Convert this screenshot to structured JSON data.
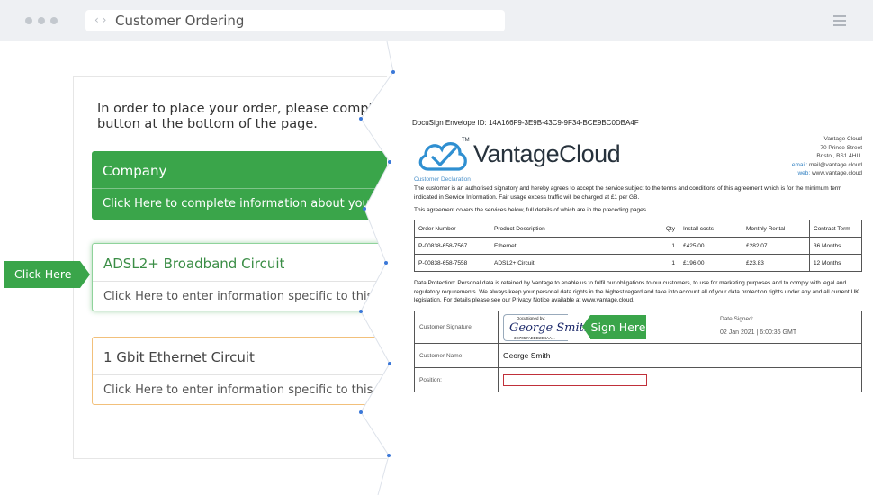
{
  "window": {
    "title": "Customer Ordering"
  },
  "form": {
    "intro": "In order to place your order, please complete all the information required for each section. Click on a section to start, then click the submit button at the bottom of the page.",
    "intro_visible_line1": "In order to place your order, please complete all",
    "intro_visible_line2": "button at the bottom of the page.",
    "cards": [
      {
        "title": "Company",
        "subtitle": "Click Here to complete information about your company",
        "state": "complete",
        "color": "#3aa54a"
      },
      {
        "title": "ADSL2+ Broadband Circuit",
        "subtitle": "Click Here to enter information specific to this Broadband circuit",
        "state": "active",
        "color": "#8fd39b"
      },
      {
        "title": "1 Gbit Ethernet Circuit",
        "subtitle": "Click Here to enter information specific to this Ethernet Service",
        "state": "pending",
        "color": "#f2c07b"
      }
    ],
    "click_here_label": "Click Here"
  },
  "document": {
    "envelope_id": "DocuSign Envelope ID: 14A166F9-3E9B-43C9-9F34-BCE9BC0DBA4F",
    "brand": "VantageCloud",
    "brand_tm": "TM",
    "vendor": {
      "name": "Vantage Cloud",
      "street": "70 Prince Street",
      "city": "Bristol, BS1 4HU.",
      "email_label": "email:",
      "email": "mail@vantage.cloud",
      "web_label": "web:",
      "web": "www.vantage.cloud"
    },
    "declaration_heading": "Customer Declaration",
    "declaration": "The customer is an authorised signatory and hereby agrees to accept the service subject to the terms and conditions of this agreement which is for the minimum term indicated in Service Information. Fair usage excess traffic will be charged at £1 per GB.",
    "covers": "This agreement covers the services below, full details of which are in the preceding pages.",
    "table": {
      "headers": [
        "Order Number",
        "Product Description",
        "Qty",
        "Install costs",
        "Monthly Rental",
        "Contract Term"
      ],
      "rows": [
        [
          "P-00838-658-7567",
          "Ethernet",
          "1",
          "£425.00",
          "£282.07",
          "36 Months"
        ],
        [
          "P-00838-658-7558",
          "ADSL2+ Circuit",
          "1",
          "£196.00",
          "£23.83",
          "12 Months"
        ]
      ]
    },
    "data_protection": "Data Protection: Personal data is retained by Vantage to enable us to fulfil our obligations to our customers, to use for marketing purposes and to comply with legal and regulatory requirements. We always keep your personal data rights in the highest regard and take into account all of your data protection rights under any and all current UK legislation. For details please see our Privacy Notice available at www.vantage.cloud.",
    "signature": {
      "sig_label": "Customer Signature:",
      "docusigned_by": "DocuSigned by:",
      "signature_text": "George Smith",
      "signature_id": "3C7057AEED2E4AA...",
      "date_label": "Date Signed:",
      "date_value": "02 Jan 2021 | 6:00:36 GMT",
      "name_label": "Customer Name:",
      "name_value": "George Smith",
      "position_label": "Position:",
      "position_value": ""
    },
    "sign_here_label": "Sign Here"
  },
  "colors": {
    "accent_green": "#3aa54a",
    "brand_blue": "#2f7fc1",
    "pending_orange": "#f2c07b",
    "field_error": "#c0303a"
  }
}
